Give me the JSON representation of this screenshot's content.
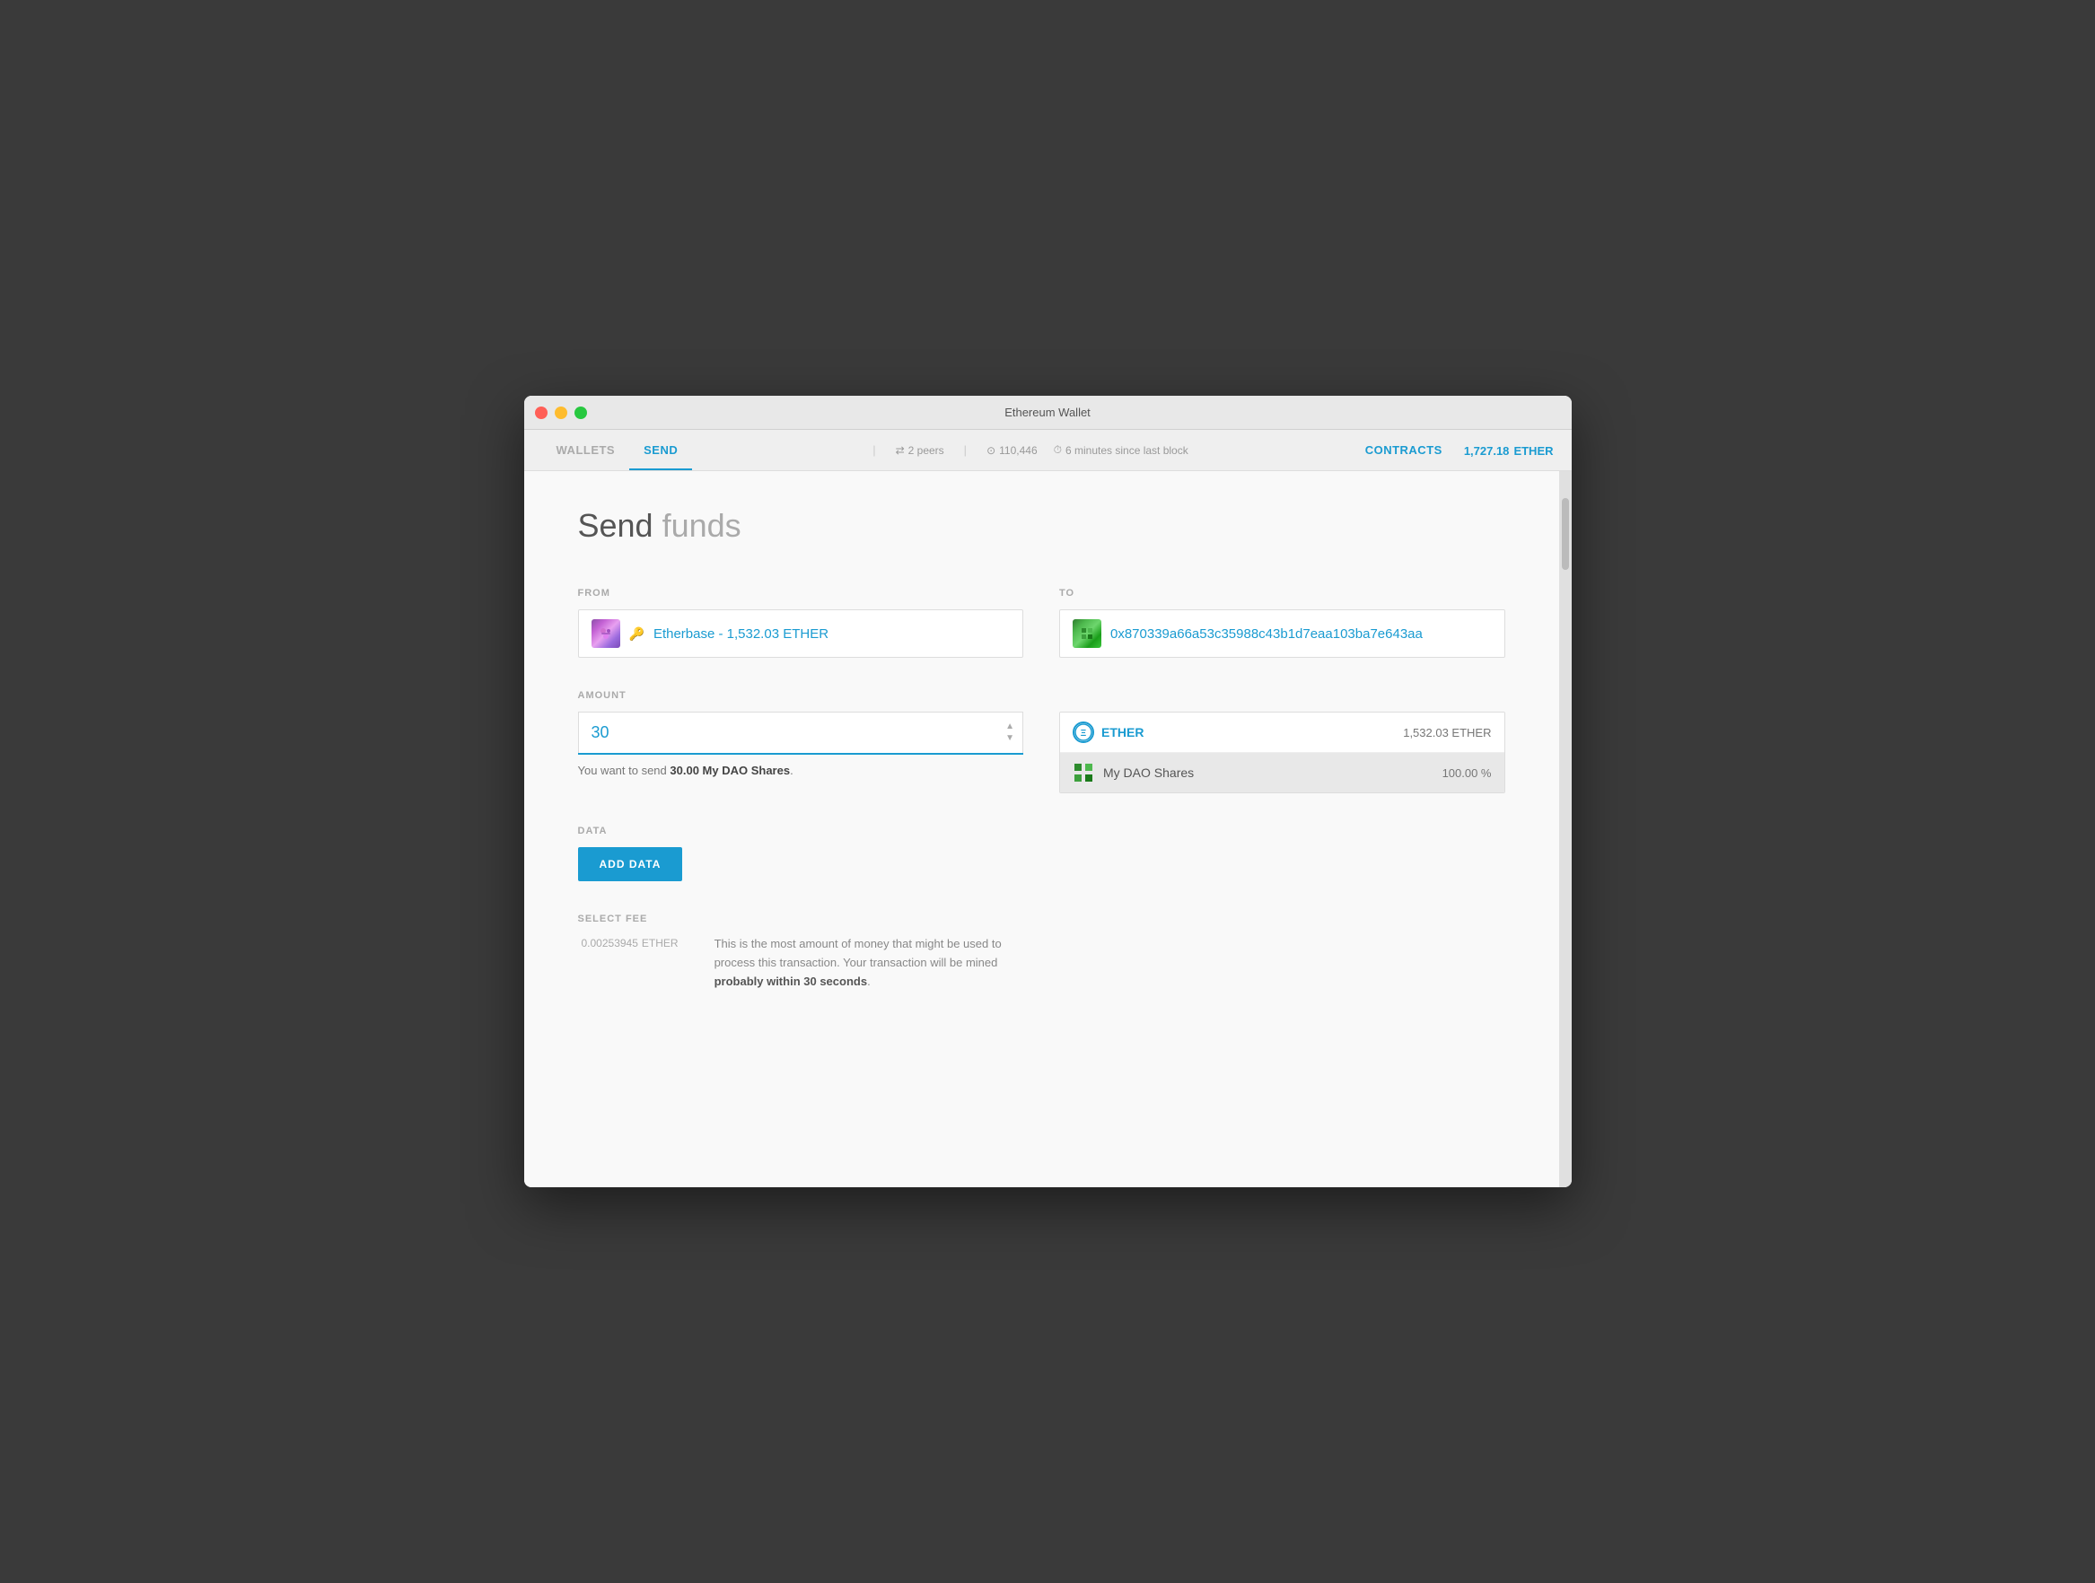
{
  "window": {
    "title": "Ethereum Wallet"
  },
  "navbar": {
    "tabs": [
      {
        "id": "wallets",
        "label": "WALLETS",
        "active": false
      },
      {
        "id": "send",
        "label": "SEND",
        "active": true
      }
    ],
    "divider": "|",
    "status": {
      "peers": "2 peers",
      "blocks": "110,446",
      "time": "6 minutes since last block"
    },
    "contracts_label": "CONTRACTS",
    "balance": "1,727.18",
    "balance_unit": "ETHER"
  },
  "page": {
    "title_strong": "Send",
    "title_light": " funds"
  },
  "from": {
    "label": "FROM",
    "avatar_emoji": "🟣",
    "address_text": "Etherbase - 1,532.03 ETHER",
    "key_icon": "🔑"
  },
  "to": {
    "label": "TO",
    "address": "0x870339a66a53c35988c43b1d7eaa103ba7e643aa"
  },
  "amount": {
    "label": "AMOUNT",
    "value": "30",
    "hint_prefix": "You want to send ",
    "hint_bold": "30.00 My DAO Shares",
    "hint_suffix": "."
  },
  "currency_options": [
    {
      "id": "ether",
      "label": "ETHER",
      "amount": "1,532.03 ETHER",
      "selected": false
    },
    {
      "id": "dao",
      "label": "My DAO Shares",
      "amount": "100.00 %",
      "selected": true
    }
  ],
  "data_section": {
    "label": "DATA",
    "button_label": "ADD DATA"
  },
  "fee_section": {
    "label": "SELECT FEE",
    "value": "0.00253945",
    "unit": "ETHER",
    "description_line1": "This is the most amount of money that might be used to",
    "description_line2": "process this transaction. Your transaction will be mined",
    "description_line3_bold": "probably within 30 seconds",
    "description_line3_suffix": "."
  }
}
